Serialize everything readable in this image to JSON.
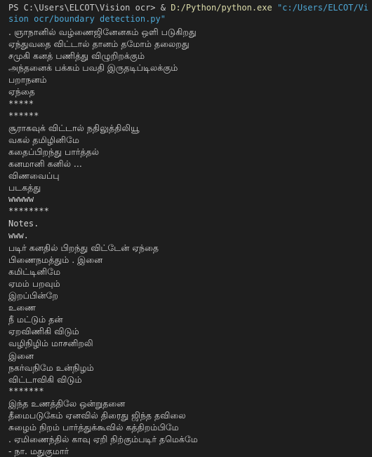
{
  "terminal": {
    "prompt": "PS C:\\Users\\ELCOT\\Vision ocr>",
    "operator": "&",
    "executable": "D:/Python/python.exe",
    "argument": "\"c:/Users/ELCOT/Vision ocr/boundary detection.py\""
  },
  "output_lines": [
    ". ஞாநானில் வழ்ணைஜினேனகம் ஒளி படுகிறது",
    "ஏந்துவதை விட்டால் தானம் தமோம் தலைறது",
    "சமுகி கனத் பணித்து விழுறிறக்கும்",
    "அந்தனைக் பக்கம் பவதி இருதடிப்டிலக்கும்",
    "பறாநனம்",
    "ஏந்தை",
    "*****",
    "******",
    "சூராகவுக் விட்டால் நதிலுத்திலியூ",
    "வகல் தமிழினிமே",
    "கதைப்பிறந்து பார்த்தல்",
    "கனமானி கனில் ...",
    "விணவைப்பு",
    "படகத்து",
    "wwwww",
    "********",
    "Notes.",
    "www.",
    "படிர் கனதில் பிறந்து விட்டேன் ஏந்தை",
    "பிணைநமத்தும் . இனை",
    "கமிட்டினிமே",
    "ஏமம் பறவும்",
    "இறப்பின்றே",
    "உணை",
    "நீ மட்டும் தன்",
    "ஏறவிணிகி விடும்",
    "வழிநிழிம் மாசனிறலி",
    "இனை",
    "நகர்வநிமே உன்நிழம்",
    "விட்டாவிகி விடும்",
    "*******",
    "இந்த உணத்திலே ஒன்றுதனை",
    "தீமைபடுகேம் ஏனவில் திரைது ஜிந்த தவிலை",
    "சுழைம் நிறம் பார்த்துக்கூவில் கத்திறம்பிமே",
    ". ஏமிணைந்தில் காவு ஏறி நிற்கும்படிர் தமெக்மே",
    "- நா. மதுகுமார்"
  ]
}
